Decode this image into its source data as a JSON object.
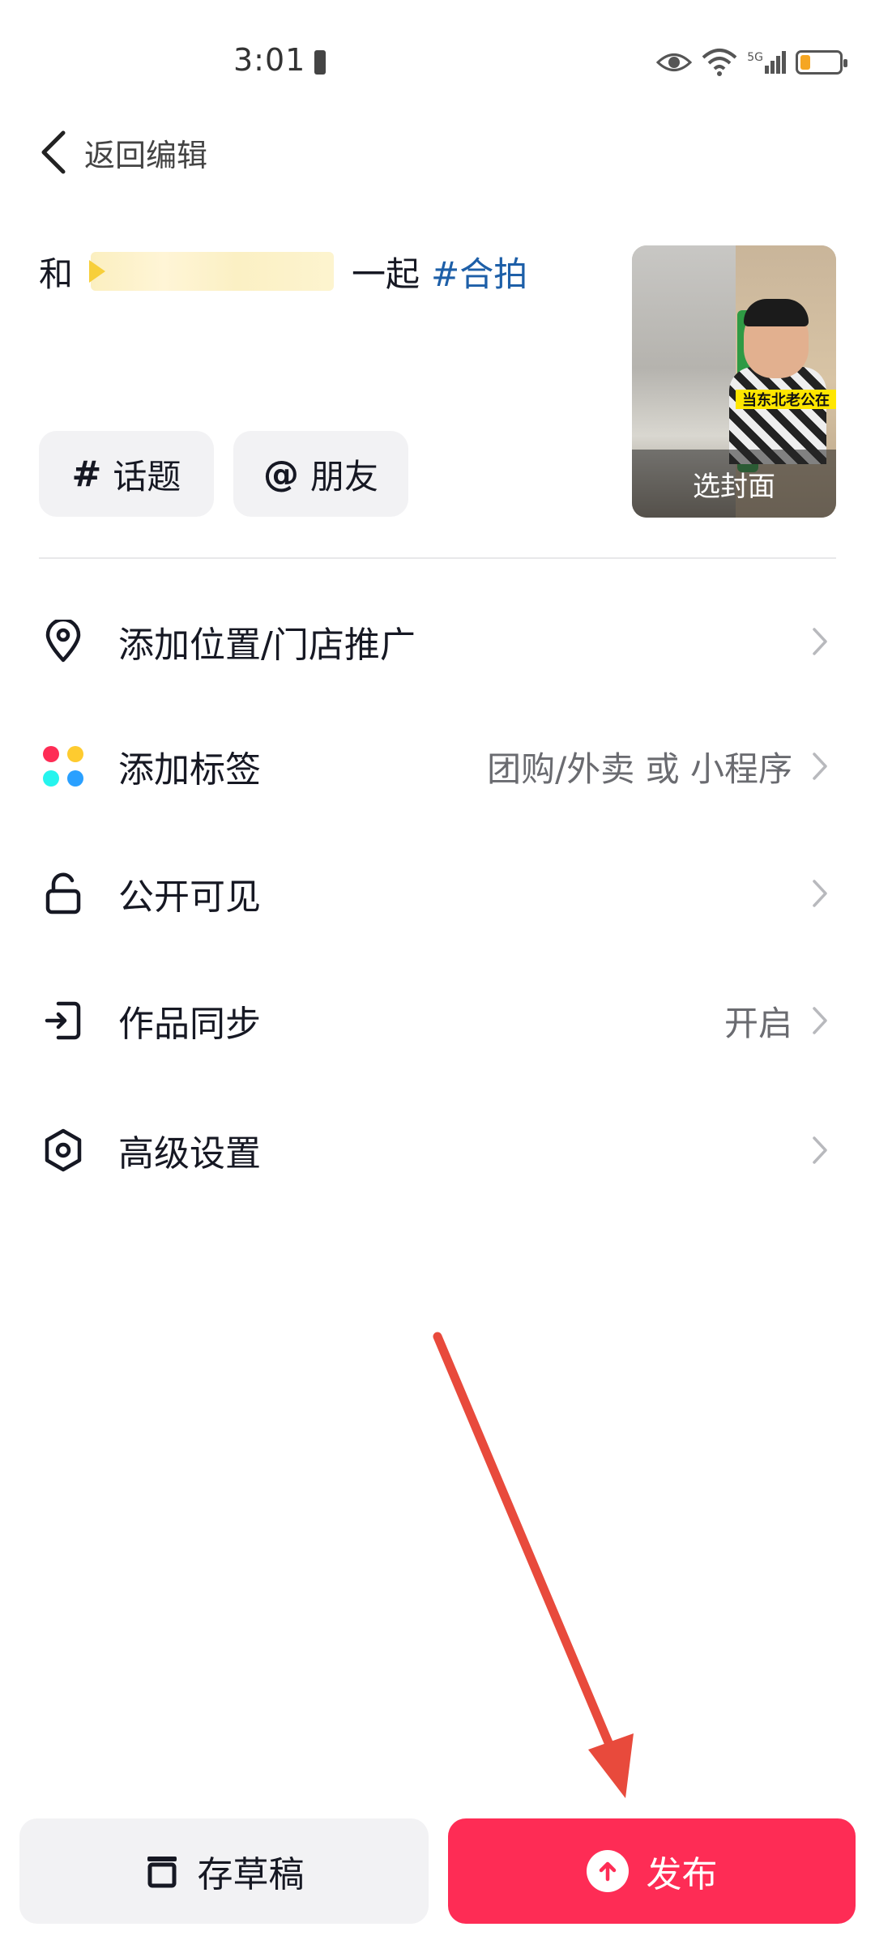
{
  "status_bar": {
    "time": "3:01",
    "network": "5G"
  },
  "header": {
    "back_label": "返回编辑"
  },
  "caption": {
    "prefix": "和",
    "middle": "一起",
    "hashtag": "#合拍"
  },
  "chips": {
    "topic_label": "话题",
    "topic_symbol": "#",
    "friend_label": "朋友",
    "friend_symbol": "@"
  },
  "cover": {
    "label": "选封面",
    "overlay_text": "当东北老公在"
  },
  "menu": [
    {
      "label": "添加位置/门店推广",
      "value": "",
      "icon": "location-pin-icon"
    },
    {
      "label": "添加标签",
      "value": "团购/外卖 或 小程序",
      "icon": "colorful-dots-icon"
    },
    {
      "label": "公开可见",
      "value": "",
      "icon": "unlock-icon"
    },
    {
      "label": "作品同步",
      "value": "开启",
      "icon": "sync-export-icon"
    },
    {
      "label": "高级设置",
      "value": "",
      "icon": "hexagon-settings-icon"
    }
  ],
  "bottom": {
    "draft_label": "存草稿",
    "publish_label": "发布"
  },
  "colors": {
    "publish": "#fe2c55",
    "hashtag": "#1d5fa8",
    "annotation_arrow": "#e84a3c"
  }
}
